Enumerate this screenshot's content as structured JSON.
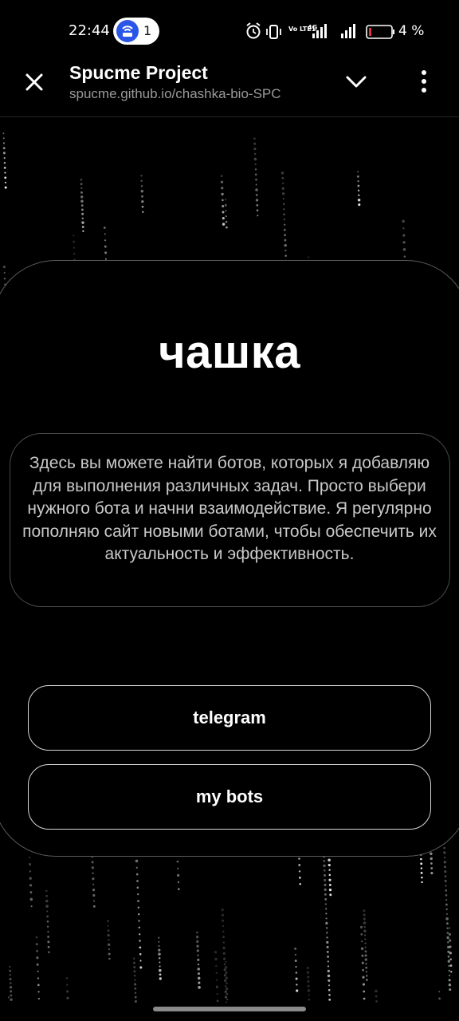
{
  "status_bar": {
    "time": "22:44",
    "hotspot_count": "1",
    "net_labels": [
      "Vo LTE1",
      "Vo LTE2"
    ],
    "net_type": "4G",
    "battery_text": "4 %",
    "icons": [
      "hotspot-icon",
      "alarm-icon",
      "vibrate-icon",
      "signal-icon",
      "battery-icon"
    ],
    "battery_color": "#e0303a"
  },
  "browser_header": {
    "title": "Spucme Project",
    "url": "spucme.github.io/chashka-bio-SPC",
    "icons": [
      "close-icon",
      "chevron-down-icon",
      "more-vertical-icon"
    ]
  },
  "page": {
    "title": "чашка",
    "description": "Здесь вы можете найти ботов, которых я добавляю для выполнения различных задач. Просто выбери нужного бота и начни взаимодействие. Я регулярно пополняю сайт новыми ботами, чтобы обеспечить их актуальность и эффективность.",
    "buttons": [
      {
        "label": "telegram"
      },
      {
        "label": "my bots"
      }
    ]
  },
  "colors": {
    "background": "#000000",
    "text": "#ffffff",
    "muted_text": "#9a9a9a",
    "card_border": "#5a5a5a",
    "button_border": "#d6d6d6",
    "hotspot_accent": "#2a56e8"
  }
}
